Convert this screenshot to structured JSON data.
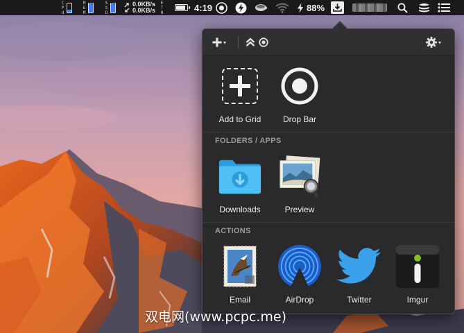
{
  "menubar": {
    "cpu_label": "CPU",
    "mem_label": "MEM",
    "ssd_label": "SSD",
    "net_up": "0.0KB/s",
    "net_down": "0.0KB/s",
    "eth_label": "ETH",
    "cpu_level": 0.25,
    "mem_level": 0.85,
    "ssd_level": 0.85,
    "time": "4:19",
    "battery_percent": "88%",
    "icons": [
      "battery-icon",
      "target-icon",
      "bolt-circle-icon",
      "coffee-icon",
      "wifi-icon",
      "charging-icon",
      "download-box-icon",
      "spotlight-search-icon",
      "layers-icon",
      "notification-list-icon"
    ]
  },
  "toolbar": {
    "add_caret": "▾",
    "settings_caret": "▾"
  },
  "sections": {
    "top_tiles": [
      {
        "label": "Add to Grid",
        "icon": "add-to-grid-icon"
      },
      {
        "label": "Drop Bar",
        "icon": "drop-bar-icon"
      }
    ],
    "folders_header": "FOLDERS / APPS",
    "folders": [
      {
        "label": "Downloads",
        "icon": "downloads-folder-icon"
      },
      {
        "label": "Preview",
        "icon": "preview-app-icon"
      }
    ],
    "actions_header": "ACTIONS",
    "actions": [
      {
        "label": "Email",
        "icon": "email-stamp-icon"
      },
      {
        "label": "AirDrop",
        "icon": "airdrop-icon"
      },
      {
        "label": "Twitter",
        "icon": "twitter-bird-icon"
      },
      {
        "label": "Imgur",
        "icon": "imgur-icon"
      }
    ]
  },
  "watermark": "双电网(www.pcpc.me)",
  "colors": {
    "menubar_bg": "#1a1a1c",
    "panel_bg": "#2a2a2c",
    "meter_fill": "#3d7bff",
    "folder_blue": "#3fb7f0",
    "airdrop_blue": "#1f6fe0",
    "twitter_blue": "#3aa0ea",
    "imgur_green": "#85bf25"
  }
}
